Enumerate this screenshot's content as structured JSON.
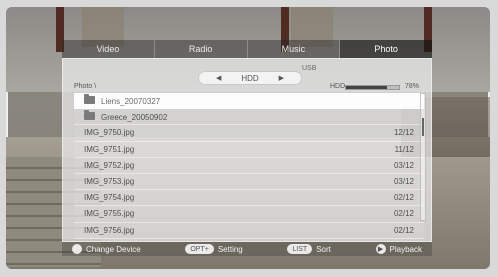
{
  "tabs": [
    {
      "label": "Video"
    },
    {
      "label": "Radio"
    },
    {
      "label": "Music"
    },
    {
      "label": "Photo"
    }
  ],
  "device": {
    "selected": "HDD",
    "alt": "USB",
    "prev_arrow": "◀",
    "next_arrow": "▶"
  },
  "browser": {
    "path": "Photo \\",
    "storage_label": "HDD",
    "storage_used_percent": "78%",
    "storage_fill_fraction": 0.78
  },
  "items": [
    {
      "type": "folder",
      "name": "Liens_20070327",
      "date": ""
    },
    {
      "type": "folder",
      "name": "Greece_20050902",
      "date": ""
    },
    {
      "type": "file",
      "name": "IMG_9750.jpg",
      "date": "12/12"
    },
    {
      "type": "file",
      "name": "IMG_9751.jpg",
      "date": "11/12"
    },
    {
      "type": "file",
      "name": "IMG_9752.jpg",
      "date": "03/12"
    },
    {
      "type": "file",
      "name": "IMG_9753.jpg",
      "date": "03/12"
    },
    {
      "type": "file",
      "name": "IMG_9754.jpg",
      "date": "02/12"
    },
    {
      "type": "file",
      "name": "IMG_9755.jpg",
      "date": "02/12"
    },
    {
      "type": "file",
      "name": "IMG_9756.jpg",
      "date": "02/12"
    }
  ],
  "footer": {
    "change_device": "Change Device",
    "opt_key": "OPT+",
    "setting": "Setting",
    "list_key": "LIST",
    "sort": "Sort",
    "play_glyph": "▶",
    "playback": "Playback"
  }
}
